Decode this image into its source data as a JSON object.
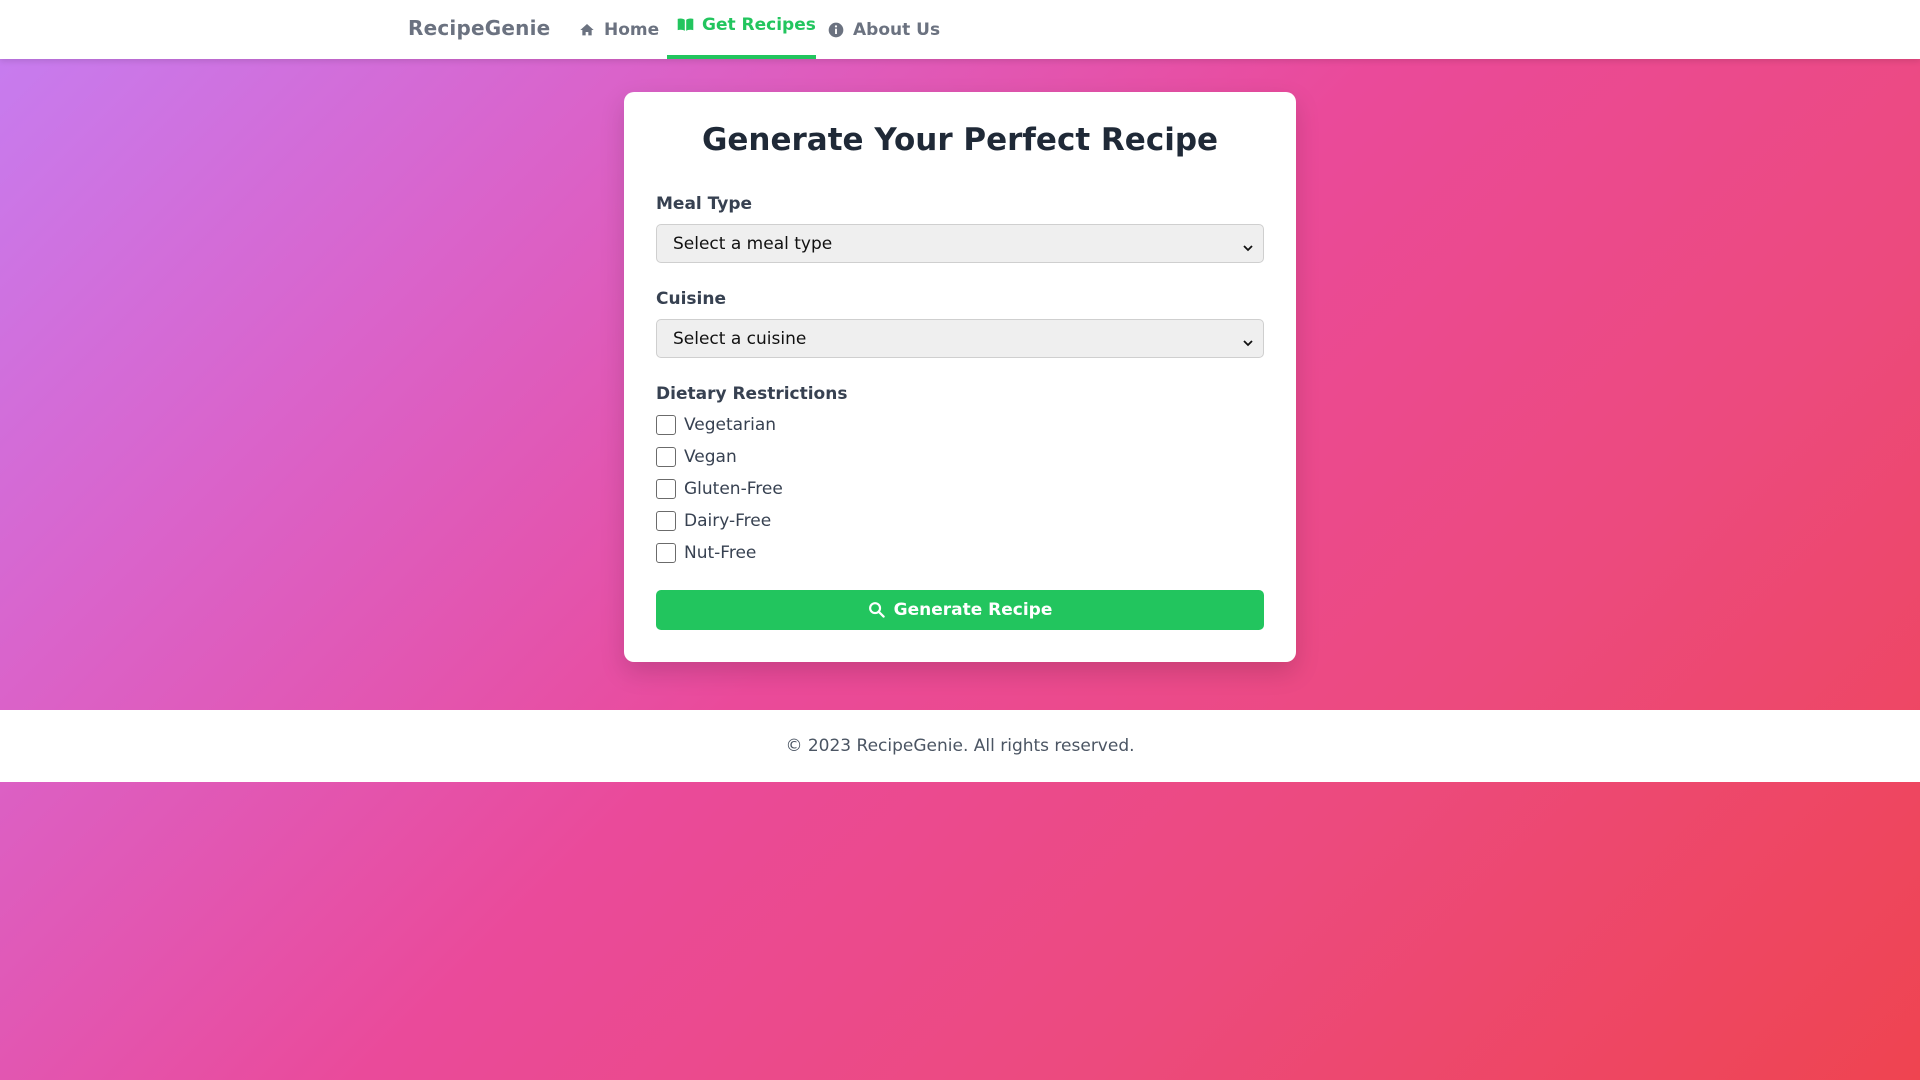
{
  "nav": {
    "brand": "RecipeGenie",
    "items": [
      {
        "label": "Home",
        "icon": "home-icon",
        "active": false
      },
      {
        "label": "Get Recipes",
        "icon": "book-open-icon",
        "active": true
      },
      {
        "label": "About Us",
        "icon": "info-circle-icon",
        "active": false
      }
    ]
  },
  "form": {
    "title": "Generate Your Perfect Recipe",
    "meal_type": {
      "label": "Meal Type",
      "selected": "Select a meal type"
    },
    "cuisine": {
      "label": "Cuisine",
      "selected": "Select a cuisine"
    },
    "dietary": {
      "label": "Dietary Restrictions",
      "options": [
        {
          "label": "Vegetarian",
          "checked": false
        },
        {
          "label": "Vegan",
          "checked": false
        },
        {
          "label": "Gluten-Free",
          "checked": false
        },
        {
          "label": "Dairy-Free",
          "checked": false
        },
        {
          "label": "Nut-Free",
          "checked": false
        }
      ]
    },
    "submit_label": "Generate Recipe",
    "submit_icon": "search-icon"
  },
  "footer": {
    "text": "© 2023 RecipeGenie. All rights reserved."
  },
  "colors": {
    "accent": "#22c55e",
    "nav_text": "#6b7280",
    "title_text": "#1f2937",
    "gradient_start": "#c57ef2",
    "gradient_mid": "#ea4a9a",
    "gradient_end": "#ef4450"
  }
}
